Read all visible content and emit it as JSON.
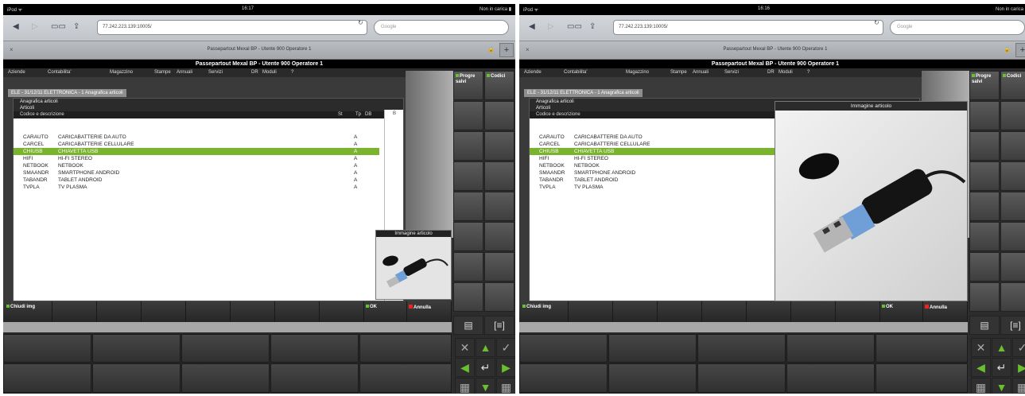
{
  "status": {
    "carrier": "iPod ᯤ",
    "battery": "Non in carica ▮"
  },
  "panels": [
    {
      "time": "16:17",
      "image_mode": "thumbnail"
    },
    {
      "time": "16:16",
      "image_mode": "enlarged"
    }
  ],
  "browser": {
    "back_icon": "back-arrow-icon",
    "forward_icon": "forward-arrow-icon",
    "bookmarks_icon": "book-icon",
    "share_icon": "share-icon",
    "url": "77.242.223.139:10005/",
    "search_placeholder": "Google",
    "tab_title": "Passepartout Mexal BP - Utente 900 Operatore 1",
    "tab_close": "×",
    "tab_add": "+"
  },
  "app": {
    "title": "Passepartout Mexal BP - Utente 900 Operatore 1",
    "menu": [
      "Aziende",
      "Contabilita'",
      "Magazzino",
      "Stampe",
      "Annuali",
      "Servizi",
      "DR",
      "Moduli",
      "?"
    ],
    "breadcrumb": "ELE - 31/12/11 ELETTRONICA - 1 Anagrafica articoli"
  },
  "list_window": {
    "title": "Anagrafica articoli",
    "subtitle": "Articoli",
    "columns": {
      "code_desc": "Codice e descrizione",
      "st": "St",
      "tp": "Tp",
      "db": "DB"
    },
    "rows": [
      {
        "code": "CARAUTO",
        "desc": "CARICABATTERIE DA AUTO",
        "tp": "A",
        "selected": false
      },
      {
        "code": "CARCEL",
        "desc": "CARICABATTERIE CELLULARE",
        "tp": "A",
        "selected": false
      },
      {
        "code": "CHIUSB",
        "desc": "CHIAVETTA USB",
        "tp": "A",
        "selected": true
      },
      {
        "code": "HIFI",
        "desc": "HI-FI STEREO",
        "tp": "A",
        "selected": false
      },
      {
        "code": "NETBOOK",
        "desc": "NETBOOK",
        "tp": "A",
        "selected": false
      },
      {
        "code": "SMAANDR",
        "desc": "SMARTPHONE ANDROID",
        "tp": "A",
        "selected": false
      },
      {
        "code": "TABANDR",
        "desc": "TABLET ANDROID",
        "tp": "A",
        "selected": false
      },
      {
        "code": "TVPLA",
        "desc": "TV PLASMA",
        "tp": "A",
        "selected": false
      }
    ],
    "scroll_marker": "B"
  },
  "image_window": {
    "title": "Immagine articolo"
  },
  "buttons": {
    "close_img": "Chiudi img",
    "ok": "OK",
    "cancel": "Annulla"
  },
  "right_panel": {
    "progre_saved": "Progre salvi",
    "codici": "Codici"
  },
  "icons": {
    "form": "form-icon",
    "zoom": "zoom-icon",
    "close": "close-icon",
    "up": "up-arrow-icon",
    "check": "check-icon",
    "left": "left-arrow-icon",
    "enter": "enter-icon",
    "right": "right-arrow-icon",
    "grid": "grid-icon",
    "down": "down-arrow-icon",
    "calendar": "calendar-icon"
  },
  "colors": {
    "selection": "#7ab32c",
    "accent_green": "#6bbf2e",
    "cancel_red": "#e22222"
  }
}
